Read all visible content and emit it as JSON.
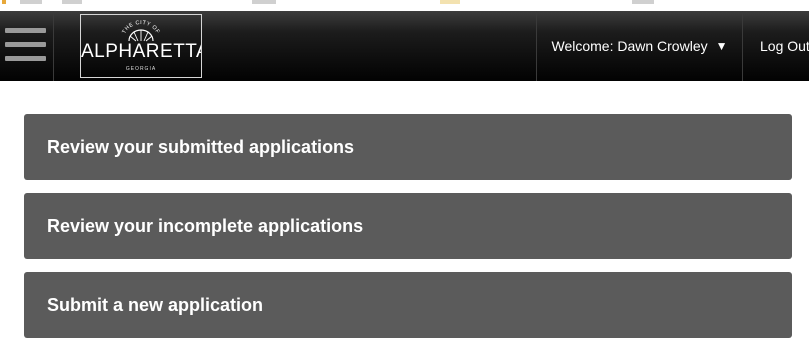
{
  "header": {
    "logo": {
      "arc_text": "THE CITY OF",
      "city": "ALPHARETTA",
      "state": "GEORGIA"
    },
    "welcome_label": "Welcome: Dawn Crowley",
    "welcome_caret": "▼",
    "logout_label": "Log Out"
  },
  "actions": {
    "submitted": "Review your submitted applications",
    "incomplete": "Review your incomplete applications",
    "new_app": "Submit a new application"
  },
  "colors": {
    "navbar": "#020202",
    "button_bg": "#5b5b5b",
    "button_text": "#ffffff"
  }
}
